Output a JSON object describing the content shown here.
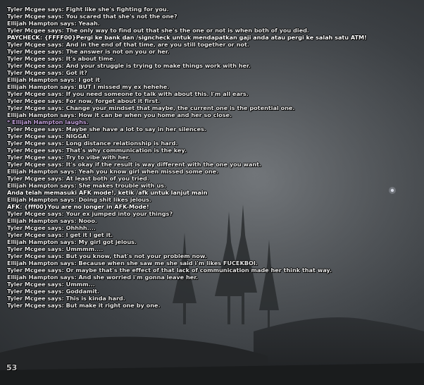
{
  "chat": {
    "colors": {
      "say": "#e6e6e6",
      "me": "#c2a2da",
      "system": "#ffffff"
    },
    "lines": [
      {
        "text": "Tyler Mcgee says: Fight like she's fighting for you.",
        "kind": "say"
      },
      {
        "text": "Tyler Mcgee says: You scared that she's not the one?",
        "kind": "say"
      },
      {
        "text": "Ellijah Hampton says: Yeaah.",
        "kind": "say"
      },
      {
        "text": "Tyler Mcgee says: The only way to find out that she's the one or not is when both of you died.",
        "kind": "say"
      },
      {
        "text": "PAYCHECK: {FFFF00}Pergi ke bank dan /signcheck untuk mendapatkan gaji anda atau pergi ke salah satu ATM!",
        "kind": "system"
      },
      {
        "text": "Tyler Mcgee says: And in the end of that time, are you still together or not.",
        "kind": "say"
      },
      {
        "text": "Tyler Mcgee says: The answer is not on you or her.",
        "kind": "say"
      },
      {
        "text": "Tyler Mcgee says: It's about time.",
        "kind": "say"
      },
      {
        "text": "Tyler Mcgee says: And your struggle is trying to make things work with her.",
        "kind": "say"
      },
      {
        "text": "Tyler Mcgee says: Got it?",
        "kind": "say"
      },
      {
        "text": "Ellijah Hampton says: I got it",
        "kind": "say"
      },
      {
        "text": "Ellijah Hampton says: BUT I missed my ex hehehe.",
        "kind": "say"
      },
      {
        "text": "Tyler Mcgee says: If you need someone to talk with about this. I'm all ears.",
        "kind": "say"
      },
      {
        "text": "Tyler Mcgee says: For now, forget about it first.",
        "kind": "say"
      },
      {
        "text": "Tyler Mcgee says: Change your mindset that maybe, the current one is the potential one.",
        "kind": "say"
      },
      {
        "text": "Ellijah Hampton says: How it can be when you home and her so close.",
        "kind": "say"
      },
      {
        "text": "* Ellijah Hampton laughs.",
        "kind": "me"
      },
      {
        "text": "Tyler Mcgee says: Maybe she have a lot to say in her silences.",
        "kind": "say"
      },
      {
        "text": "Tyler Mcgee says: NIGGA!",
        "kind": "say"
      },
      {
        "text": "Tyler Mcgee says: Long distance relationship is hard.",
        "kind": "say"
      },
      {
        "text": "Tyler Mcgee says: That's why communication is the key.",
        "kind": "say"
      },
      {
        "text": "Tyler Mcgee says: Try to vibe with her.",
        "kind": "say"
      },
      {
        "text": "Tyler Mcgee says: It's okay if the result is way different with the one you want.",
        "kind": "say"
      },
      {
        "text": "Ellijah Hampton says: Yeah you know girl when missed some one.",
        "kind": "say"
      },
      {
        "text": "Tyler Mcgee says: At least both of you tried.",
        "kind": "say"
      },
      {
        "text": "Ellijah Hampton says: She makes trouble with us.",
        "kind": "say"
      },
      {
        "text": "Anda telah memasuki AFK mode!, ketik /afk untuk lanjut main",
        "kind": "system"
      },
      {
        "text": "Ellijah Hampton says: Doing shit likes jelous.",
        "kind": "say"
      },
      {
        "text": "AFK: {fff00}You are no longer in AFK-Mode!",
        "kind": "system"
      },
      {
        "text": "Tyler Mcgee says: Your ex jumped into your things?",
        "kind": "say"
      },
      {
        "text": "Ellijah Hampton says: Nooo.",
        "kind": "say"
      },
      {
        "text": "Tyler Mcgee says: Ohhhh....",
        "kind": "say"
      },
      {
        "text": "Tyler Mcgee says: I get it I get it.",
        "kind": "say"
      },
      {
        "text": "Ellijah Hampton says: My girl got jelous.",
        "kind": "say"
      },
      {
        "text": "Tyler Mcgee says: Ummmm....",
        "kind": "say"
      },
      {
        "text": "Tyler Mcgee says: But you know, that's not your problem now.",
        "kind": "say"
      },
      {
        "text": "Ellijah Hampton says: Because when she saw me she said i'm likes FUCEKBOI.",
        "kind": "say"
      },
      {
        "text": "Tyler Mcgee says: Or maybe that's the effect of that lack of communication made her think that way.",
        "kind": "say"
      },
      {
        "text": "Ellijah Hampton says: And she worried i'm gonna leave her.",
        "kind": "say"
      },
      {
        "text": "Tyler Mcgee says: Ummm...",
        "kind": "say"
      },
      {
        "text": "Tyler Mcgee says: Goddamit.",
        "kind": "say"
      },
      {
        "text": "Tyler Mcgee says: This is kinda hard.",
        "kind": "say"
      },
      {
        "text": "Tyler Mcgee says: But make it right one by one.",
        "kind": "say"
      }
    ]
  },
  "fps_counter": "53"
}
